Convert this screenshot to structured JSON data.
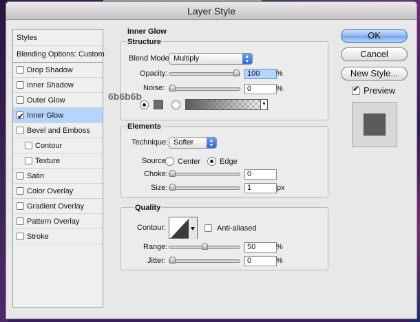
{
  "window": {
    "title": "Layer Style"
  },
  "styles_panel": {
    "header": "Styles",
    "blending": "Blending Options: Custom",
    "items": [
      {
        "label": "Drop Shadow",
        "checked": false,
        "indent": false,
        "selected": false
      },
      {
        "label": "Inner Shadow",
        "checked": false,
        "indent": false,
        "selected": false
      },
      {
        "label": "Outer Glow",
        "checked": false,
        "indent": false,
        "selected": false
      },
      {
        "label": "Inner Glow",
        "checked": true,
        "indent": false,
        "selected": true
      },
      {
        "label": "Bevel and Emboss",
        "checked": false,
        "indent": false,
        "selected": false
      },
      {
        "label": "Contour",
        "checked": false,
        "indent": true,
        "selected": false
      },
      {
        "label": "Texture",
        "checked": false,
        "indent": true,
        "selected": false
      },
      {
        "label": "Satin",
        "checked": false,
        "indent": false,
        "selected": false
      },
      {
        "label": "Color Overlay",
        "checked": false,
        "indent": false,
        "selected": false
      },
      {
        "label": "Gradient Overlay",
        "checked": false,
        "indent": false,
        "selected": false
      },
      {
        "label": "Pattern Overlay",
        "checked": false,
        "indent": false,
        "selected": false
      },
      {
        "label": "Stroke",
        "checked": false,
        "indent": false,
        "selected": false
      }
    ]
  },
  "inner_glow": {
    "title": "Inner Glow",
    "structure": {
      "title": "Structure",
      "blend_mode_label": "Blend Mode:",
      "blend_mode_value": "Multiply",
      "opacity_label": "Opacity:",
      "opacity_value": "100",
      "opacity_fraction": 1.0,
      "noise_label": "Noise:",
      "noise_value": "0",
      "noise_fraction": 0.0,
      "unit_percent": "%",
      "color_note": "6b6b6b",
      "swatch_color": "#6b6b6b"
    },
    "elements": {
      "title": "Elements",
      "technique_label": "Technique:",
      "technique_value": "Softer",
      "source_label": "Source:",
      "source_center": "Center",
      "source_edge": "Edge",
      "choke_label": "Choke:",
      "choke_value": "0",
      "choke_fraction": 0.0,
      "size_label": "Size:",
      "size_value": "1",
      "size_fraction": 0.0,
      "unit_px": "px"
    },
    "quality": {
      "title": "Quality",
      "contour_label": "Contour:",
      "anti_aliased_label": "Anti-aliased",
      "range_label": "Range:",
      "range_value": "50",
      "range_fraction": 0.5,
      "jitter_label": "Jitter:",
      "jitter_value": "0",
      "jitter_fraction": 0.0
    }
  },
  "buttons": {
    "ok": "OK",
    "cancel": "Cancel",
    "new_style": "New Style...",
    "preview": "Preview"
  },
  "colors": {
    "selection": "#b5d5ff",
    "preview_fill": "#5b5b5b"
  }
}
